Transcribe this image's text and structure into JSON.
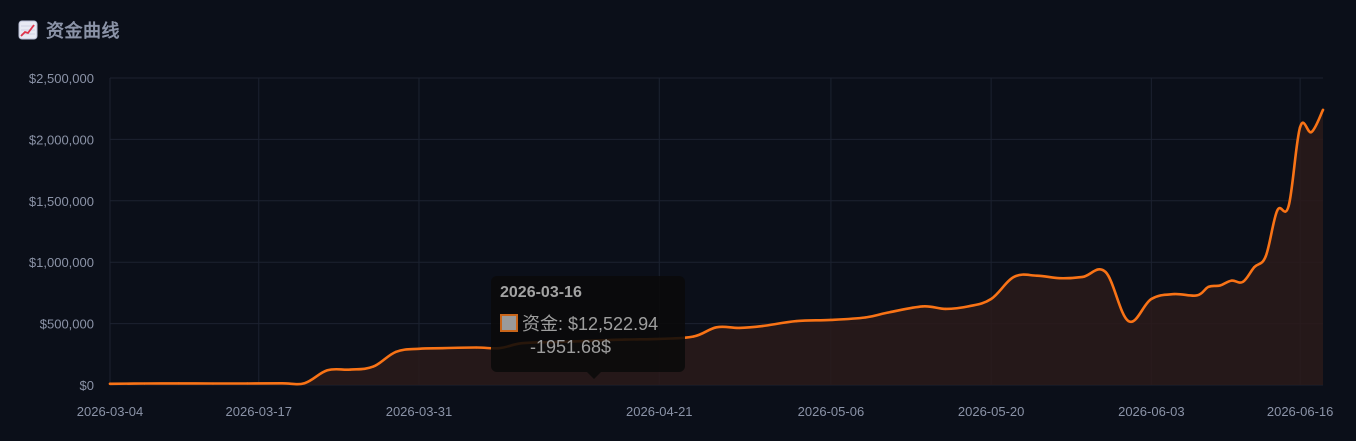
{
  "header": {
    "title": "资金曲线",
    "icon": "chart-increasing-icon"
  },
  "colors": {
    "background": "#0b0f19",
    "line": "#f97316",
    "fill": "#2a1a1a",
    "grid": "#1c2230",
    "text": "#8b93a7"
  },
  "tooltip": {
    "date": "2026-03-16",
    "label": "资金: $12,522.94",
    "sub": "-1951.68$"
  },
  "chart_data": {
    "type": "area",
    "title": "资金曲线",
    "xlabel": "",
    "ylabel": "",
    "grid": true,
    "legend": "none",
    "ylim": [
      0,
      2500000
    ],
    "y_ticks": [
      "$0",
      "$500,000",
      "$1,000,000",
      "$1,500,000",
      "$2,000,000",
      "$2,500,000"
    ],
    "y_tick_values": [
      0,
      500000,
      1000000,
      1500000,
      2000000,
      2500000
    ],
    "x_ticks": [
      "2026-03-04",
      "2026-03-17",
      "2026-03-31",
      "2026-04-21",
      "2026-05-06",
      "2026-05-20",
      "2026-06-03",
      "2026-06-16"
    ],
    "x_range": [
      "2026-03-04",
      "2026-06-18"
    ],
    "series": [
      {
        "name": "资金",
        "points": [
          [
            "2026-03-04",
            10000
          ],
          [
            "2026-03-07",
            12000
          ],
          [
            "2026-03-10",
            13000
          ],
          [
            "2026-03-13",
            12000
          ],
          [
            "2026-03-16",
            12523
          ],
          [
            "2026-03-19",
            14000
          ],
          [
            "2026-03-21",
            15000
          ],
          [
            "2026-03-23",
            120000
          ],
          [
            "2026-03-25",
            125000
          ],
          [
            "2026-03-27",
            150000
          ],
          [
            "2026-03-29",
            270000
          ],
          [
            "2026-03-31",
            295000
          ],
          [
            "2026-04-02",
            300000
          ],
          [
            "2026-04-05",
            305000
          ],
          [
            "2026-04-07",
            300000
          ],
          [
            "2026-04-09",
            340000
          ],
          [
            "2026-04-12",
            350000
          ],
          [
            "2026-04-15",
            360000
          ],
          [
            "2026-04-18",
            370000
          ],
          [
            "2026-04-21",
            375000
          ],
          [
            "2026-04-24",
            395000
          ],
          [
            "2026-04-26",
            470000
          ],
          [
            "2026-04-28",
            465000
          ],
          [
            "2026-04-30",
            480000
          ],
          [
            "2026-05-03",
            520000
          ],
          [
            "2026-05-06",
            530000
          ],
          [
            "2026-05-09",
            550000
          ],
          [
            "2026-05-11",
            590000
          ],
          [
            "2026-05-14",
            640000
          ],
          [
            "2026-05-16",
            620000
          ],
          [
            "2026-05-18",
            640000
          ],
          [
            "2026-05-20",
            700000
          ],
          [
            "2026-05-22",
            880000
          ],
          [
            "2026-05-24",
            890000
          ],
          [
            "2026-05-26",
            870000
          ],
          [
            "2026-05-28",
            880000
          ],
          [
            "2026-05-30",
            920000
          ],
          [
            "2026-06-01",
            520000
          ],
          [
            "2026-06-03",
            700000
          ],
          [
            "2026-06-05",
            740000
          ],
          [
            "2026-06-07",
            730000
          ],
          [
            "2026-06-08",
            800000
          ],
          [
            "2026-06-09",
            810000
          ],
          [
            "2026-06-10",
            850000
          ],
          [
            "2026-06-11",
            840000
          ],
          [
            "2026-06-12",
            960000
          ],
          [
            "2026-06-13",
            1050000
          ],
          [
            "2026-06-14",
            1420000
          ],
          [
            "2026-06-15",
            1460000
          ],
          [
            "2026-06-16",
            2100000
          ],
          [
            "2026-06-17",
            2060000
          ],
          [
            "2026-06-18",
            2240000
          ]
        ]
      }
    ]
  }
}
